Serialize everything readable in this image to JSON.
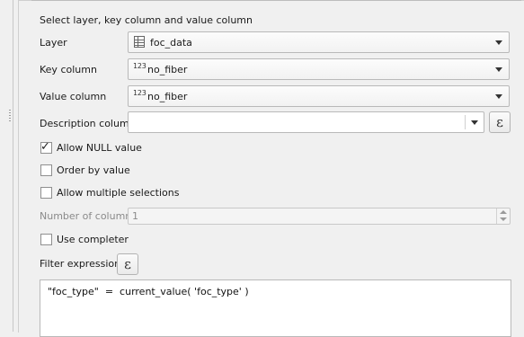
{
  "section_title": "Select layer, key column and value column",
  "layer": {
    "label": "Layer",
    "value": "foc_data",
    "icon": "table-icon"
  },
  "key_column": {
    "label": "Key column",
    "type_badge": "123",
    "value": "no_fiber"
  },
  "value_column": {
    "label": "Value column",
    "type_badge": "123",
    "value": "no_fiber"
  },
  "description_column": {
    "label": "Description column",
    "value": "",
    "expression_button": "ε"
  },
  "options": {
    "allow_null": {
      "label": "Allow NULL value",
      "checked": true
    },
    "order_by_value": {
      "label": "Order by value",
      "checked": false
    },
    "allow_multiple": {
      "label": "Allow multiple selections",
      "checked": false
    },
    "use_completer": {
      "label": "Use completer",
      "checked": false
    }
  },
  "number_of_columns": {
    "label": "Number of columns",
    "value": "1"
  },
  "filter_expression": {
    "label": "Filter expression",
    "button": "ε",
    "value": "\"foc_type\"  =  current_value( 'foc_type' )"
  },
  "tick_glyph": "✓"
}
